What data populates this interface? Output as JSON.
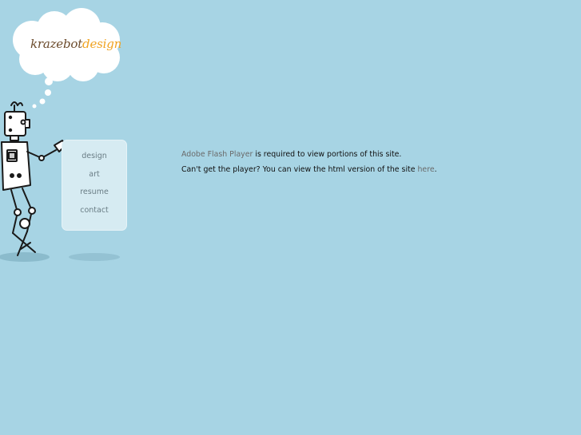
{
  "logo": {
    "brand": "krazebot",
    "accent": "design"
  },
  "nav": {
    "items": [
      {
        "label": "design"
      },
      {
        "label": "art"
      },
      {
        "label": "resume"
      },
      {
        "label": "contact"
      }
    ]
  },
  "message": {
    "flash_link": "Adobe Flash Player",
    "line1_rest": " is required to view portions of this site.",
    "line2_text": "Can't get the player? You can view the html version of the site ",
    "here_link": "here",
    "line2_end": "."
  },
  "colors": {
    "background": "#a7d4e4",
    "nav_panel": "#d6ebf2",
    "brand": "#6b4a2b",
    "accent": "#f0a321"
  },
  "icons": [
    "thought-cloud",
    "robot-mascot"
  ]
}
